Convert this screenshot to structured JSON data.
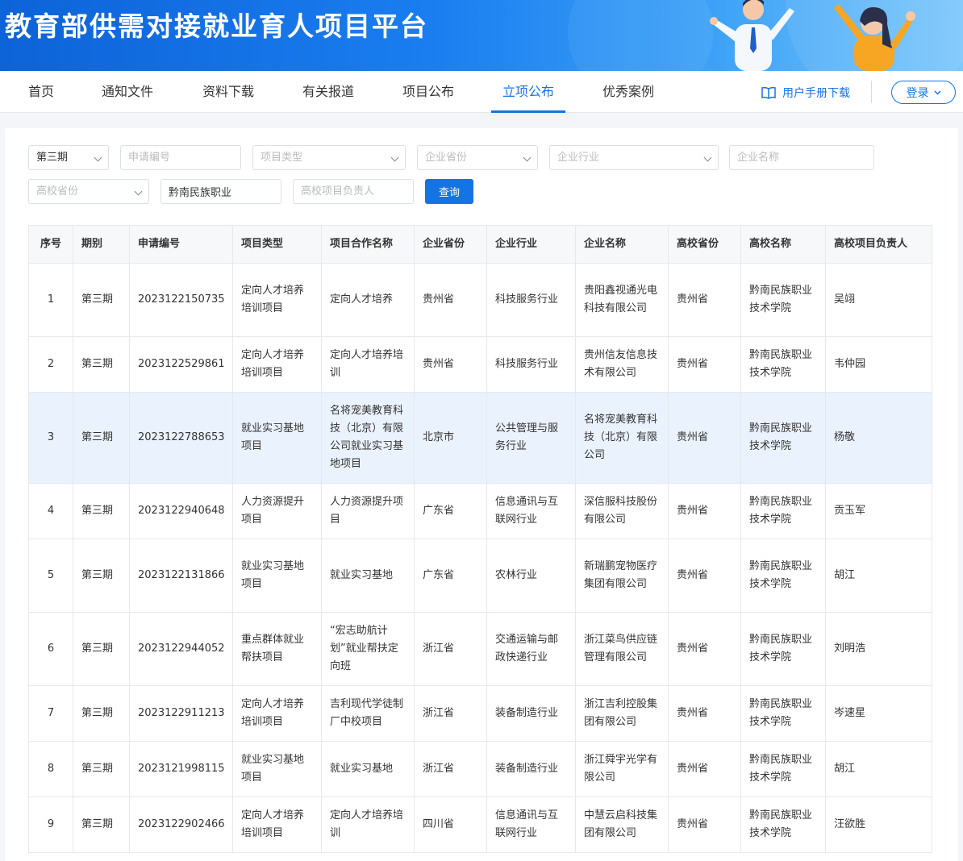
{
  "banner": {
    "title": "教育部供需对接就业育人项目平台"
  },
  "nav": {
    "items": [
      "首页",
      "通知文件",
      "资料下载",
      "有关报道",
      "项目公布",
      "立项公布",
      "优秀案例"
    ],
    "active": "立项公布",
    "manual_label": "用户手册下载",
    "login_label": "登录"
  },
  "colors": {
    "primary": "#1574e3",
    "highlight_row": "#eaf2fd"
  },
  "filters": {
    "period": "第三期",
    "apply_no_placeholder": "申请编号",
    "project_type_placeholder": "项目类型",
    "company_province_placeholder": "企业省份",
    "company_industry_placeholder": "企业行业",
    "company_name_placeholder": "企业名称",
    "school_province_placeholder": "高校省份",
    "school_name_value": "黔南民族职业",
    "school_leader_placeholder": "高校项目负责人",
    "query_label": "查询"
  },
  "table": {
    "headers": [
      "序号",
      "期别",
      "申请编号",
      "项目类型",
      "项目合作名称",
      "企业省份",
      "企业行业",
      "企业名称",
      "高校省份",
      "高校名称",
      "高校项目负责人"
    ],
    "rows": [
      [
        "1",
        "第三期",
        "2023122150735",
        "定向人才培养培训项目",
        "定向人才培养",
        "贵州省",
        "科技服务行业",
        "贵阳鑫视通光电科技有限公司",
        "贵州省",
        "黔南民族职业技术学院",
        "吴翊"
      ],
      [
        "2",
        "第三期",
        "2023122529861",
        "定向人才培养培训项目",
        "定向人才培养培训",
        "贵州省",
        "科技服务行业",
        "贵州信友信息技术有限公司",
        "贵州省",
        "黔南民族职业技术学院",
        "韦仲园"
      ],
      [
        "3",
        "第三期",
        "2023122788653",
        "就业实习基地项目",
        "名将宠美教育科技（北京）有限公司就业实习基地项目",
        "北京市",
        "公共管理与服务行业",
        "名将宠美教育科技（北京）有限公司",
        "贵州省",
        "黔南民族职业技术学院",
        "杨敬"
      ],
      [
        "4",
        "第三期",
        "2023122940648",
        "人力资源提升项目",
        "人力资源提升项目",
        "广东省",
        "信息通讯与互联网行业",
        "深信服科技股份有限公司",
        "贵州省",
        "黔南民族职业技术学院",
        "贡玉军"
      ],
      [
        "5",
        "第三期",
        "2023122131866",
        "就业实习基地项目",
        "就业实习基地",
        "广东省",
        "农林行业",
        "新瑞鹏宠物医疗集团有限公司",
        "贵州省",
        "黔南民族职业技术学院",
        "胡江"
      ],
      [
        "6",
        "第三期",
        "2023122944052",
        "重点群体就业帮扶项目",
        "“宏志助航计划”就业帮扶定向班",
        "浙江省",
        "交通运输与邮政快递行业",
        "浙江菜鸟供应链管理有限公司",
        "贵州省",
        "黔南民族职业技术学院",
        "刘明浩"
      ],
      [
        "7",
        "第三期",
        "2023122911213",
        "定向人才培养培训项目",
        "吉利现代学徒制厂中校项目",
        "浙江省",
        "装备制造行业",
        "浙江吉利控股集团有限公司",
        "贵州省",
        "黔南民族职业技术学院",
        "岑速星"
      ],
      [
        "8",
        "第三期",
        "2023121998115",
        "就业实习基地项目",
        "就业实习基地",
        "浙江省",
        "装备制造行业",
        "浙江舜宇光学有限公司",
        "贵州省",
        "黔南民族职业技术学院",
        "胡江"
      ],
      [
        "9",
        "第三期",
        "2023122902466",
        "定向人才培养培训项目",
        "定向人才培养培训",
        "四川省",
        "信息通讯与互联网行业",
        "中慧云启科技集团有限公司",
        "贵州省",
        "黔南民族职业技术学院",
        "汪欲胜"
      ]
    ]
  }
}
